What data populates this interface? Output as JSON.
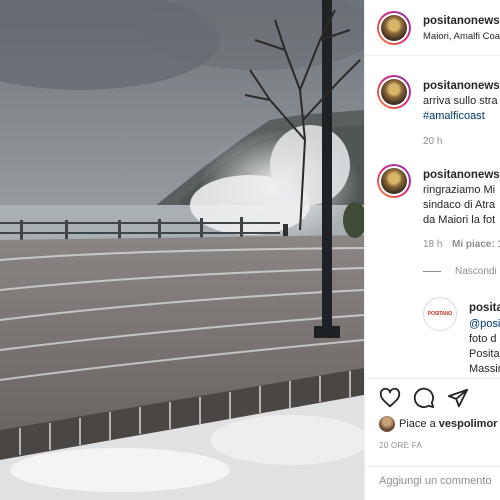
{
  "header": {
    "username": "positanonews",
    "location": "Maiori, Amalfi Coast"
  },
  "comments": [
    {
      "username": "positanonews",
      "text_prefix": "arriva sullo stra",
      "hashtag": "#amalficoast",
      "time": "20 h"
    },
    {
      "username": "positanonews",
      "lines": [
        "ringraziamo Mi",
        "sindaco di Atra",
        "da Maiori la fot"
      ],
      "time": "18 h",
      "likes": "Mi piace: 1"
    }
  ],
  "hide_replies": "Nascondi",
  "reply": {
    "username": "posita",
    "avatar_brand": "POSITANO",
    "lines": [
      "@posi",
      "foto d",
      "Positan",
      "Massin"
    ]
  },
  "likes": {
    "prefix": "Piace a",
    "user": "vespolimor"
  },
  "timestamp": "20 ORE FA",
  "add_comment": {
    "placeholder": "Aggiungi un commento"
  }
}
